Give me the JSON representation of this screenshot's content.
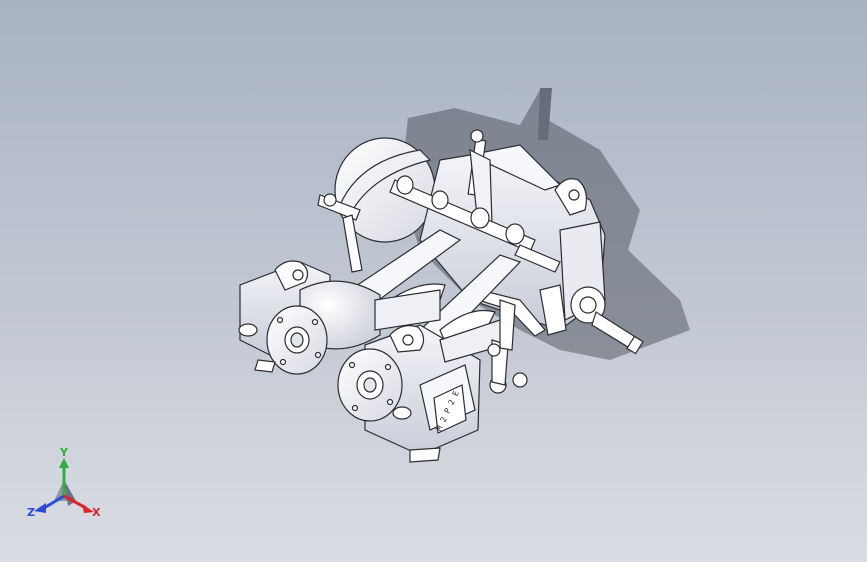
{
  "viewport": {
    "background_top": "#a9b3c4",
    "background_bottom": "#dadde3",
    "model": {
      "type": "steam-engine-assembly",
      "plate_text": "M 2 P 2 E"
    }
  },
  "triad": {
    "x_label": "X",
    "y_label": "Y",
    "z_label": "Z",
    "x_color": "#d8262b",
    "y_color": "#2fae3c",
    "z_color": "#2a4cd8"
  }
}
